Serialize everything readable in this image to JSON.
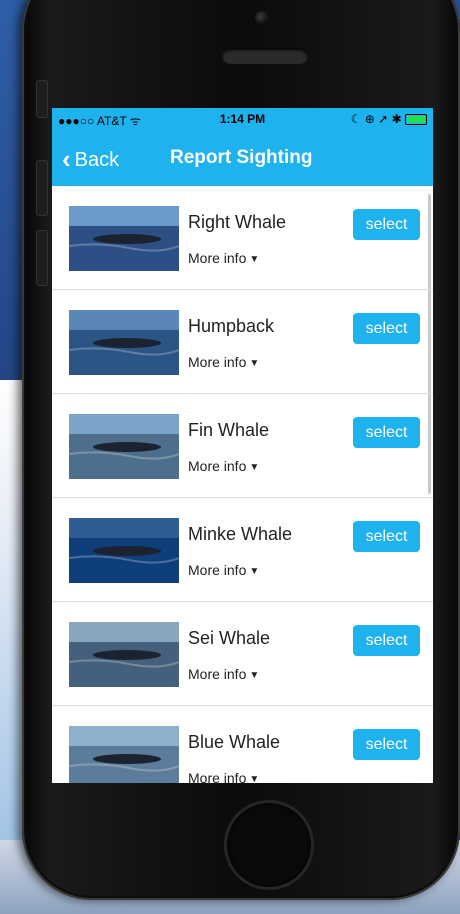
{
  "status": {
    "carrier": "●●●○○ AT&T ᯤ",
    "time": "1:14 PM",
    "icons": "☾ ⊕ ➚ ✱"
  },
  "nav": {
    "back_label": "Back",
    "title": "Report Sighting"
  },
  "colors": {
    "accent": "#1eb2ee"
  },
  "whales": [
    {
      "name": "Right Whale",
      "more": "More info",
      "select": "select"
    },
    {
      "name": "Humpback",
      "more": "More info",
      "select": "select"
    },
    {
      "name": "Fin Whale",
      "more": "More info",
      "select": "select"
    },
    {
      "name": "Minke Whale",
      "more": "More info",
      "select": "select"
    },
    {
      "name": "Sei Whale",
      "more": "More info",
      "select": "select"
    },
    {
      "name": "Blue Whale",
      "more": "More info",
      "select": "select"
    }
  ]
}
